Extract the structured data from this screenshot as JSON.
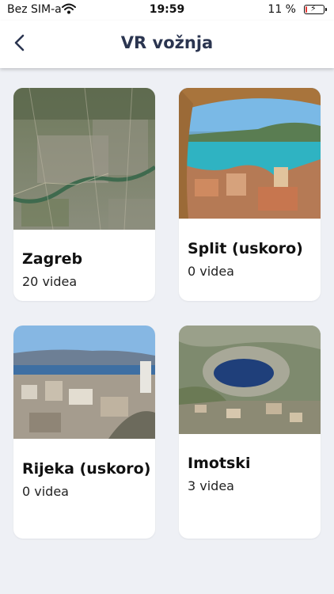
{
  "status_bar": {
    "carrier": "Bez SIM-a",
    "time": "19:59",
    "battery": "11 %",
    "battery_level": 0.11,
    "battery_fill_color": "#e53935"
  },
  "nav": {
    "title": "VR vožnja",
    "back_icon": "chevron-left-icon"
  },
  "cities": [
    {
      "name": "Zagreb",
      "count": "20 videa",
      "image": "aerial-map-zagreb"
    },
    {
      "name": "Split (uskoro)",
      "count": "0 videa",
      "image": "split-coastline"
    },
    {
      "name": "Rijeka (uskoro)",
      "count": "0 videa",
      "image": "rijeka-bay"
    },
    {
      "name": "Imotski",
      "count": "3 videa",
      "image": "imotski-blue-lake"
    }
  ],
  "colors": {
    "title": "#2b3550",
    "background": "#eef0f5"
  }
}
